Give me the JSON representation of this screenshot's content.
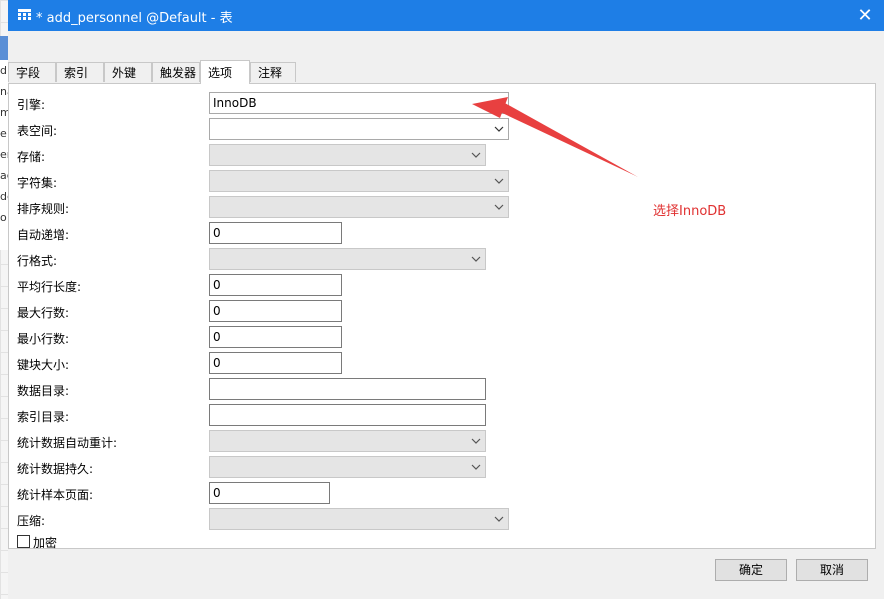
{
  "window": {
    "title": "* add_personnel @Default - 表",
    "close_symbol": "✕",
    "icon": "table-grid-icon",
    "titlebar_color": "#1e7ee6"
  },
  "background": {
    "side_letters": [
      "d",
      "na",
      "m",
      "e",
      "er",
      "ac",
      "de",
      "o"
    ]
  },
  "tabs": [
    {
      "label": "字段",
      "active": false
    },
    {
      "label": "索引",
      "active": false
    },
    {
      "label": "外键",
      "active": false
    },
    {
      "label": "触发器",
      "active": false
    },
    {
      "label": "选项",
      "active": true
    },
    {
      "label": "注释",
      "active": false
    }
  ],
  "options": {
    "engine": {
      "label": "引擎:",
      "value": "InnoDB"
    },
    "tablespace": {
      "label": "表空间:",
      "value": ""
    },
    "storage": {
      "label": "存储:",
      "value": ""
    },
    "charset": {
      "label": "字符集:",
      "value": ""
    },
    "collation": {
      "label": "排序规则:",
      "value": ""
    },
    "auto_increment": {
      "label": "自动递增:",
      "value": "0"
    },
    "row_format": {
      "label": "行格式:",
      "value": ""
    },
    "avg_row_length": {
      "label": "平均行长度:",
      "value": "0"
    },
    "max_rows": {
      "label": "最大行数:",
      "value": "0"
    },
    "min_rows": {
      "label": "最小行数:",
      "value": "0"
    },
    "key_block_size": {
      "label": "键块大小:",
      "value": "0"
    },
    "data_directory": {
      "label": "数据目录:",
      "value": ""
    },
    "index_directory": {
      "label": "索引目录:",
      "value": ""
    },
    "stats_auto_recalc": {
      "label": "统计数据自动重计:",
      "value": ""
    },
    "stats_persistent": {
      "label": "统计数据持久:",
      "value": ""
    },
    "stats_sample_pages": {
      "label": "统计样本页面:",
      "value": "0"
    },
    "compression": {
      "label": "压缩:",
      "value": ""
    },
    "encryption": {
      "label": "加密",
      "checked": false
    }
  },
  "buttons": {
    "ok": "确定",
    "cancel": "取消"
  },
  "annotation": {
    "text": "选择InnoDB",
    "color": "#e03030"
  }
}
